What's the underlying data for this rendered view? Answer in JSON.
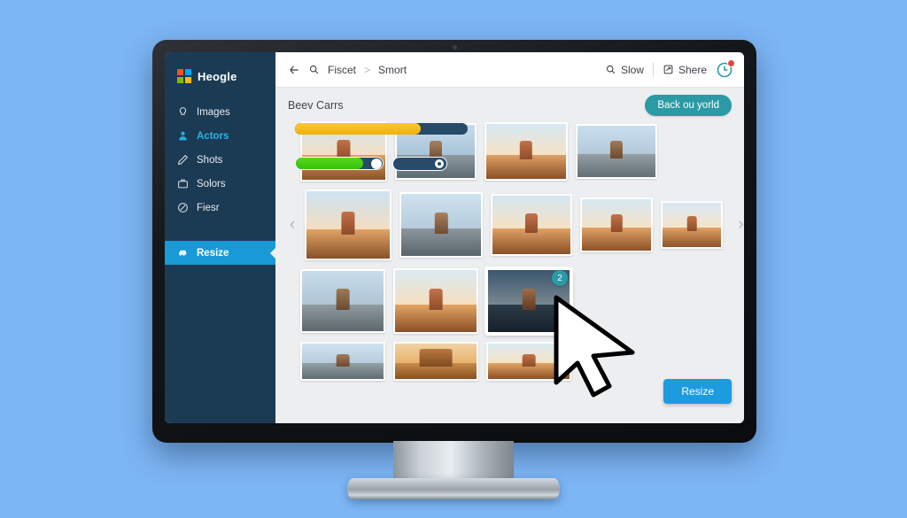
{
  "app": {
    "brand_name": "Heogle",
    "brand_colors": [
      "#f25022",
      "#00a4ef",
      "#7fba00",
      "#ffb900"
    ]
  },
  "sidebar": {
    "items": [
      {
        "label": "Images",
        "icon": "lightbulb-icon",
        "state": "normal"
      },
      {
        "label": "Actors",
        "icon": "person-icon",
        "state": "highlighted"
      },
      {
        "label": "Shots",
        "icon": "pen-icon",
        "state": "normal"
      },
      {
        "label": "Solors",
        "icon": "briefcase-icon",
        "state": "normal"
      },
      {
        "label": "Fiesr",
        "icon": "circle-slash-icon",
        "state": "normal"
      },
      {
        "label": "Resize",
        "icon": "car-icon",
        "state": "selected"
      }
    ],
    "highlight_color": "#2bb3e8",
    "selected_color": "#199ad6",
    "background_color": "#1b3a54"
  },
  "topbar": {
    "back_icon": "back-arrow-icon",
    "search_icon": "search-icon",
    "breadcrumb": [
      "Fiscet",
      "Smort"
    ],
    "breadcrumb_separator": ">",
    "actions": [
      {
        "label": "Slow",
        "icon": "search-icon"
      },
      {
        "label": "Shere",
        "icon": "share-box-icon"
      }
    ],
    "notification": {
      "icon": "clock-icon",
      "has_badge": true,
      "badge_color": "#e8443a"
    }
  },
  "content": {
    "section_title": "Beev Carrs",
    "primary_button": "Back ou yorld",
    "primary_button_color": "#2a9aa5",
    "resize_button": "Resize",
    "resize_button_color": "#1d9bdf",
    "selection_badge": "2",
    "prev_arrow": "‹",
    "next_arrow": "›",
    "rows": [
      {
        "name": "row-1",
        "thumbs": [
          {
            "w": 98,
            "h": 68,
            "scene": "desert-rock-warm"
          },
          {
            "w": 92,
            "h": 64,
            "scene": "desert-rock-cool"
          },
          {
            "w": 94,
            "h": 66,
            "scene": "desert-rock-warm"
          },
          {
            "w": 92,
            "h": 62,
            "scene": "desert-rock-cool"
          }
        ]
      },
      {
        "name": "row-2",
        "thumbs": [
          {
            "w": 98,
            "h": 80,
            "scene": "desert-rock-warm"
          },
          {
            "w": 94,
            "h": 74,
            "scene": "desert-rock-cool"
          },
          {
            "w": 92,
            "h": 70,
            "scene": "desert-rock-warm"
          },
          {
            "w": 82,
            "h": 62,
            "scene": "desert-rock-warm"
          },
          {
            "w": 70,
            "h": 54,
            "scene": "desert-rock-warm"
          }
        ]
      },
      {
        "name": "row-3",
        "thumbs": [
          {
            "w": 96,
            "h": 72,
            "scene": "desert-rock-cool"
          },
          {
            "w": 96,
            "h": 74,
            "scene": "desert-rock-warm"
          },
          {
            "w": 96,
            "h": 74,
            "scene": "desert-rock-night"
          }
        ]
      },
      {
        "name": "row-4",
        "thumbs": [
          {
            "w": 96,
            "h": 44,
            "scene": "desert-rock-cool"
          },
          {
            "w": 96,
            "h": 44,
            "scene": "desert-arch-warm"
          },
          {
            "w": 96,
            "h": 44,
            "scene": "desert-rock-warm"
          }
        ]
      }
    ],
    "overlays": {
      "progress_bar": {
        "value": 73,
        "fill_color": "#edb00f",
        "track_color": "#274b68"
      },
      "slider": {
        "value": 78,
        "fill_color": "#34c107",
        "track_color": "#274b68"
      },
      "toggle": {
        "state": "on",
        "track_color": "#274b68"
      }
    }
  },
  "desktop": {
    "background_color": "#7db6f5"
  }
}
